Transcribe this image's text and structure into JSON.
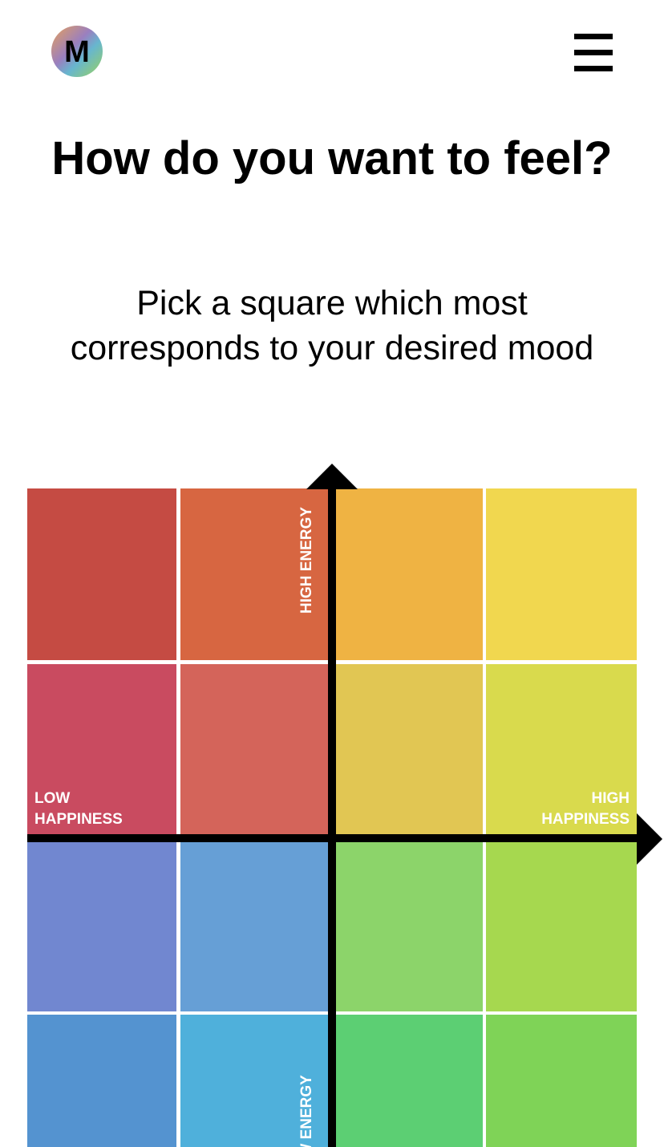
{
  "header": {
    "logo_letter": "M",
    "logo_icon": "m-logo-icon",
    "menu_icon": "hamburger-menu-icon"
  },
  "main": {
    "title": "How do you want to feel?",
    "subtitle": "Pick a square which most corresponds to your desired mood"
  },
  "mood_grid": {
    "axis_labels": {
      "high_energy": "HIGH ENERGY",
      "low_energy": "LOW ENERGY",
      "low_happiness_line1": "LOW",
      "low_happiness_line2": "HAPPINESS",
      "high_happiness_line1": "HIGH",
      "high_happiness_line2": "HAPPINESS"
    },
    "rows": [
      [
        "#c54b43",
        "#d76641",
        "#efb343",
        "#f1d74f"
      ],
      [
        "#c94b60",
        "#d4645a",
        "#e1c653",
        "#d9da4d"
      ],
      [
        "#7187d0",
        "#669fd6",
        "#8cd46a",
        "#a6d84f"
      ],
      [
        "#5493d0",
        "#4fb0db",
        "#5ccf73",
        "#7fd357"
      ]
    ],
    "divider_color": "#ffffff",
    "axis_color": "#000000"
  }
}
